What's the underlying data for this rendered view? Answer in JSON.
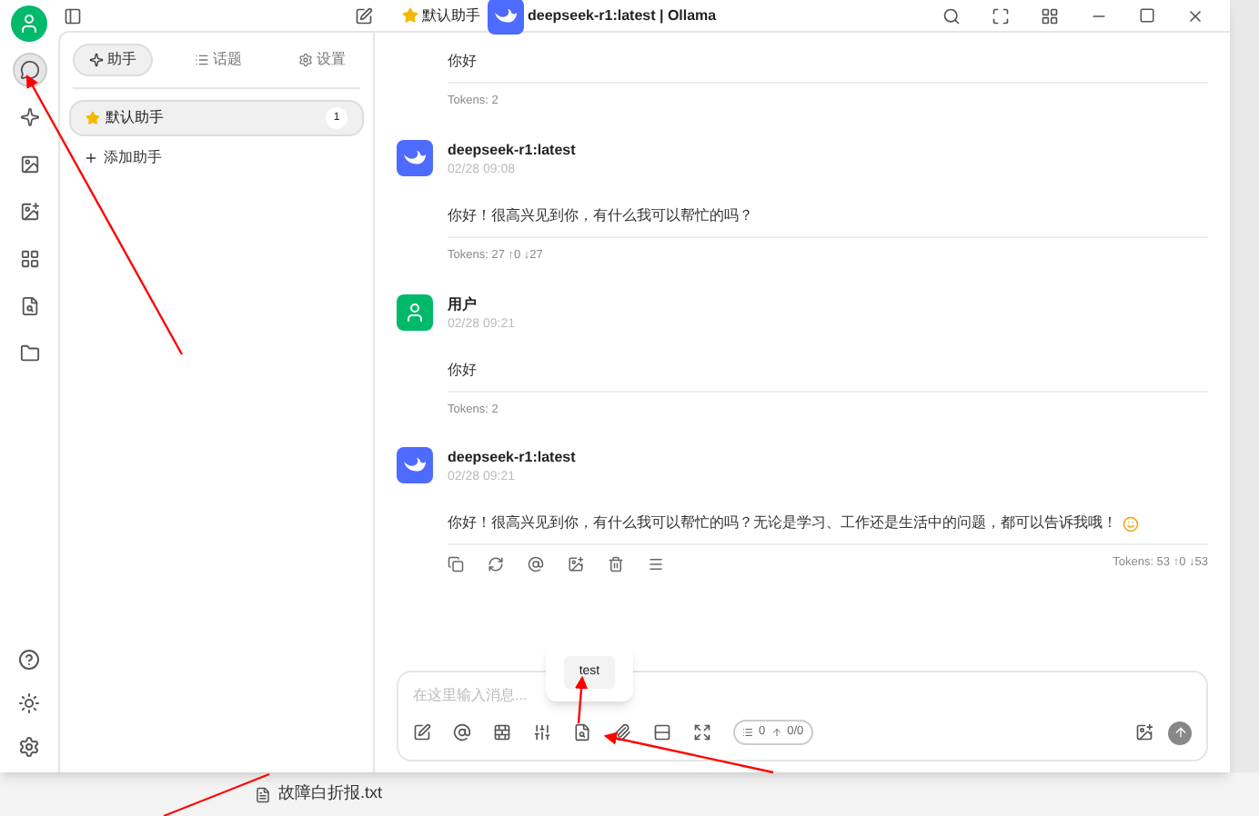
{
  "title_bar": {
    "assistant": "默认助手",
    "model": "deepseek-r1:latest | Ollama"
  },
  "rail": {
    "items": [
      {
        "selected": true
      },
      {
        "selected": false
      },
      {
        "selected": false
      },
      {
        "selected": false
      },
      {
        "selected": false
      },
      {
        "selected": false
      },
      {
        "selected": false
      }
    ]
  },
  "sidebar": {
    "tabs": [
      {
        "label": "助手",
        "selected": true
      },
      {
        "label": "话题",
        "selected": false
      },
      {
        "label": "设置",
        "selected": false
      }
    ],
    "assistants": [
      {
        "name": "默认助手",
        "count": "1",
        "selected": true
      }
    ],
    "add_label": "添加助手"
  },
  "messages": [
    {
      "text": "你好",
      "tokens": "Tokens: 2"
    },
    {
      "kind": "assistant",
      "name": "deepseek-r1:latest",
      "time": "02/28 09:08",
      "text": "你好！很高兴见到你，有什么我可以帮忙的吗？",
      "tokens": "Tokens: 27 ↑0 ↓27"
    },
    {
      "kind": "user",
      "name": "用户",
      "time": "02/28 09:21",
      "text": "你好",
      "tokens": "Tokens: 2"
    },
    {
      "kind": "assistant",
      "name": "deepseek-r1:latest",
      "time": "02/28 09:21",
      "text": "你好！很高兴见到你，有什么我可以帮忙的吗？无论是学习、工作还是生活中的问题，都可以告诉我哦！",
      "emoji": true,
      "actions": true,
      "tokens": "Tokens: 53 ↑0 ↓53"
    }
  ],
  "composer": {
    "placeholder": "在这里输入消息...",
    "tooltip": "test",
    "context": "0",
    "usage": "0/0"
  },
  "desktop": {
    "file": "故障白折报.txt"
  }
}
